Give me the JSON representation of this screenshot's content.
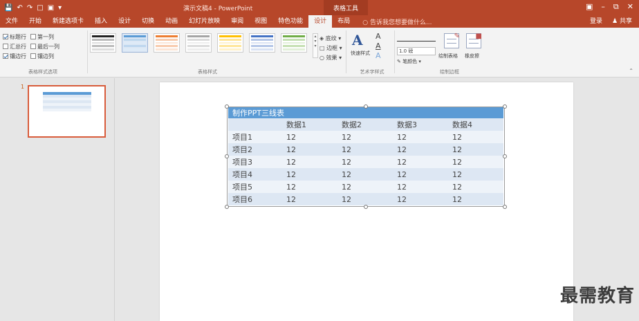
{
  "titlebar": {
    "title": "演示文稿4 - PowerPoint",
    "tools_label": "表格工具",
    "qat_icons": [
      "save-icon",
      "undo-icon",
      "redo-icon",
      "new-icon",
      "open-icon",
      "customize-icon"
    ]
  },
  "tabs": {
    "items": [
      "文件",
      "开始",
      "新建选项卡",
      "插入",
      "设计",
      "切换",
      "动画",
      "幻灯片放映",
      "审阅",
      "视图",
      "特色功能",
      "设计",
      "布局"
    ],
    "active_index": 11,
    "tell_me": "告诉我您想要做什么...",
    "login": "登录",
    "share": "共享"
  },
  "ribbon": {
    "options": [
      {
        "label": "标题行",
        "checked": true
      },
      {
        "label": "第一列",
        "checked": false
      },
      {
        "label": "汇总行",
        "checked": false
      },
      {
        "label": "最后一列",
        "checked": false
      },
      {
        "label": "镶边行",
        "checked": true
      },
      {
        "label": "镶边列",
        "checked": false
      }
    ],
    "options_group_label": "表格样式选项",
    "styles_group_label": "表格样式",
    "style_colors": [
      "#222222",
      "#5b9bd5",
      "#ed7d31",
      "#a5a5a5",
      "#ffc000",
      "#4472c4",
      "#70ad47"
    ],
    "shading_label": "底纹",
    "border_label": "边框",
    "effects_label": "效果",
    "quick_style_label": "快速样式",
    "art_group_label": "艺术字样式",
    "line_weight": "1.0 磅",
    "pen_color_label": "笔颜色",
    "draw_table_label": "绘制表格",
    "eraser_label": "橡皮擦",
    "draw_group_label": "绘制边框"
  },
  "slide_pane": {
    "slide_number": "1"
  },
  "table": {
    "title": "制作PPT三线表",
    "headers": [
      "",
      "数据1",
      "数据2",
      "数据3",
      "数据4"
    ],
    "rows": [
      [
        "项目1",
        "12",
        "12",
        "12",
        "12"
      ],
      [
        "项目2",
        "12",
        "12",
        "12",
        "12"
      ],
      [
        "项目3",
        "12",
        "12",
        "12",
        "12"
      ],
      [
        "项目4",
        "12",
        "12",
        "12",
        "12"
      ],
      [
        "项目5",
        "12",
        "12",
        "12",
        "12"
      ],
      [
        "项目6",
        "12",
        "12",
        "12",
        "12"
      ]
    ]
  },
  "watermark": "最需教育"
}
